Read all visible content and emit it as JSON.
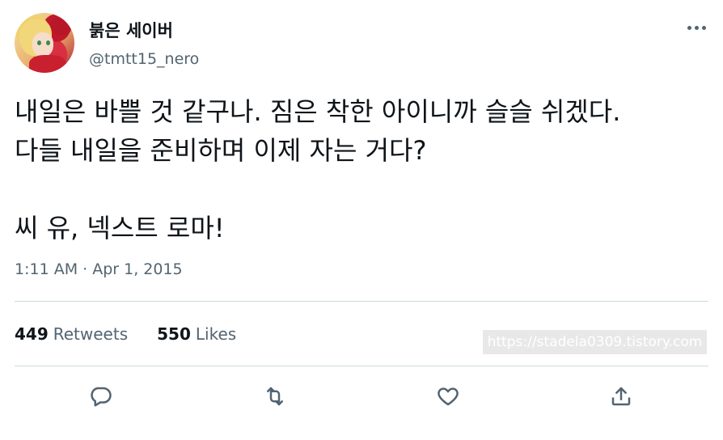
{
  "user": {
    "display_name": "붉은 세이버",
    "handle": "@tmtt15_nero",
    "avatar_icon": "avatar-image"
  },
  "tweet": {
    "lines": [
      "내일은 바쁠 것 같구나. 짐은 착한 아이니까 슬슬 쉬겠다.",
      "다들 내일을 준비하며 이제 자는 거다?",
      "",
      "씨 유, 넥스트 로마!"
    ],
    "timestamp": "1:11 AM · Apr 1, 2015"
  },
  "stats": {
    "retweets_count": "449",
    "retweets_label": "Retweets",
    "likes_count": "550",
    "likes_label": "Likes"
  },
  "watermark": "https://stadela0309.tistory.com",
  "actions": {
    "reply_icon": "reply-icon",
    "retweet_icon": "retweet-icon",
    "like_icon": "heart-icon",
    "share_icon": "share-icon"
  },
  "colors": {
    "text": "#0f1419",
    "secondary": "#536471",
    "divider": "#cfd9de"
  }
}
